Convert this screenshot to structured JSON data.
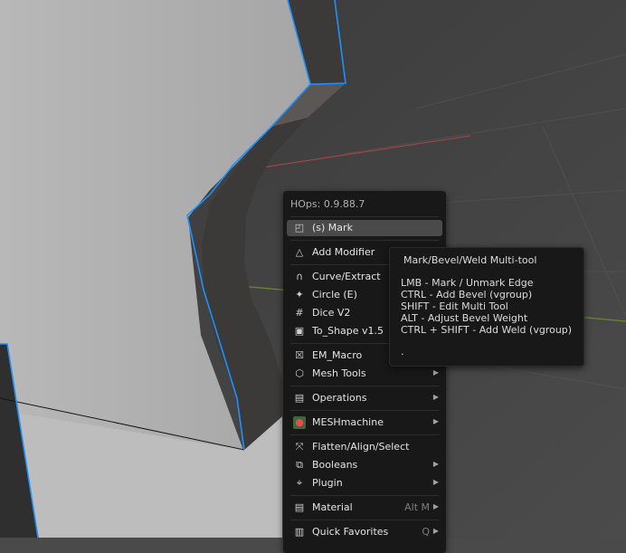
{
  "menu": {
    "title": "HOps: 0.9.88.7",
    "items": [
      {
        "label": "(s) Mark",
        "icon": "mark-tool-icon"
      },
      {
        "label": "Add Modifier",
        "icon": "triangle-icon"
      },
      {
        "label": "Curve/Extract",
        "icon": "curve-icon"
      },
      {
        "label": "Circle (E)",
        "icon": "circle-sparkle-icon"
      },
      {
        "label": "Dice V2",
        "icon": "grid-icon"
      },
      {
        "label": "To_Shape v1.5",
        "icon": "cube-icon"
      },
      {
        "label": "EM_Macro",
        "icon": "em-macro-icon"
      },
      {
        "label": "Mesh Tools",
        "icon": "mesh-icon"
      },
      {
        "label": "Operations",
        "icon": "operations-icon"
      },
      {
        "label": "MESHmachine",
        "icon": "meshmachine-icon"
      },
      {
        "label": "Flatten/Align/Select",
        "icon": "flatten-icon"
      },
      {
        "label": "Booleans",
        "icon": "booleans-icon"
      },
      {
        "label": "Plugin",
        "icon": "plugin-icon"
      },
      {
        "label": "Material",
        "icon": "material-icon",
        "shortcut": "Alt M"
      },
      {
        "label": "Quick Favorites",
        "icon": "favorites-icon",
        "shortcut": "Q"
      }
    ]
  },
  "tooltip": {
    "title": "Mark/Bevel/Weld Multi-tool",
    "lines": [
      "LMB - Mark / Unmark Edge",
      "CTRL - Add Bevel (vgroup)",
      "SHIFT - Edit Multi Tool",
      "ALT - Adjust Bevel Weight",
      "CTRL + SHIFT - Add Weld (vgroup)",
      "."
    ]
  },
  "colors": {
    "selection_outline": "#1e90ff",
    "menu_bg": "#181818",
    "active_item": "#4a4a4a"
  }
}
